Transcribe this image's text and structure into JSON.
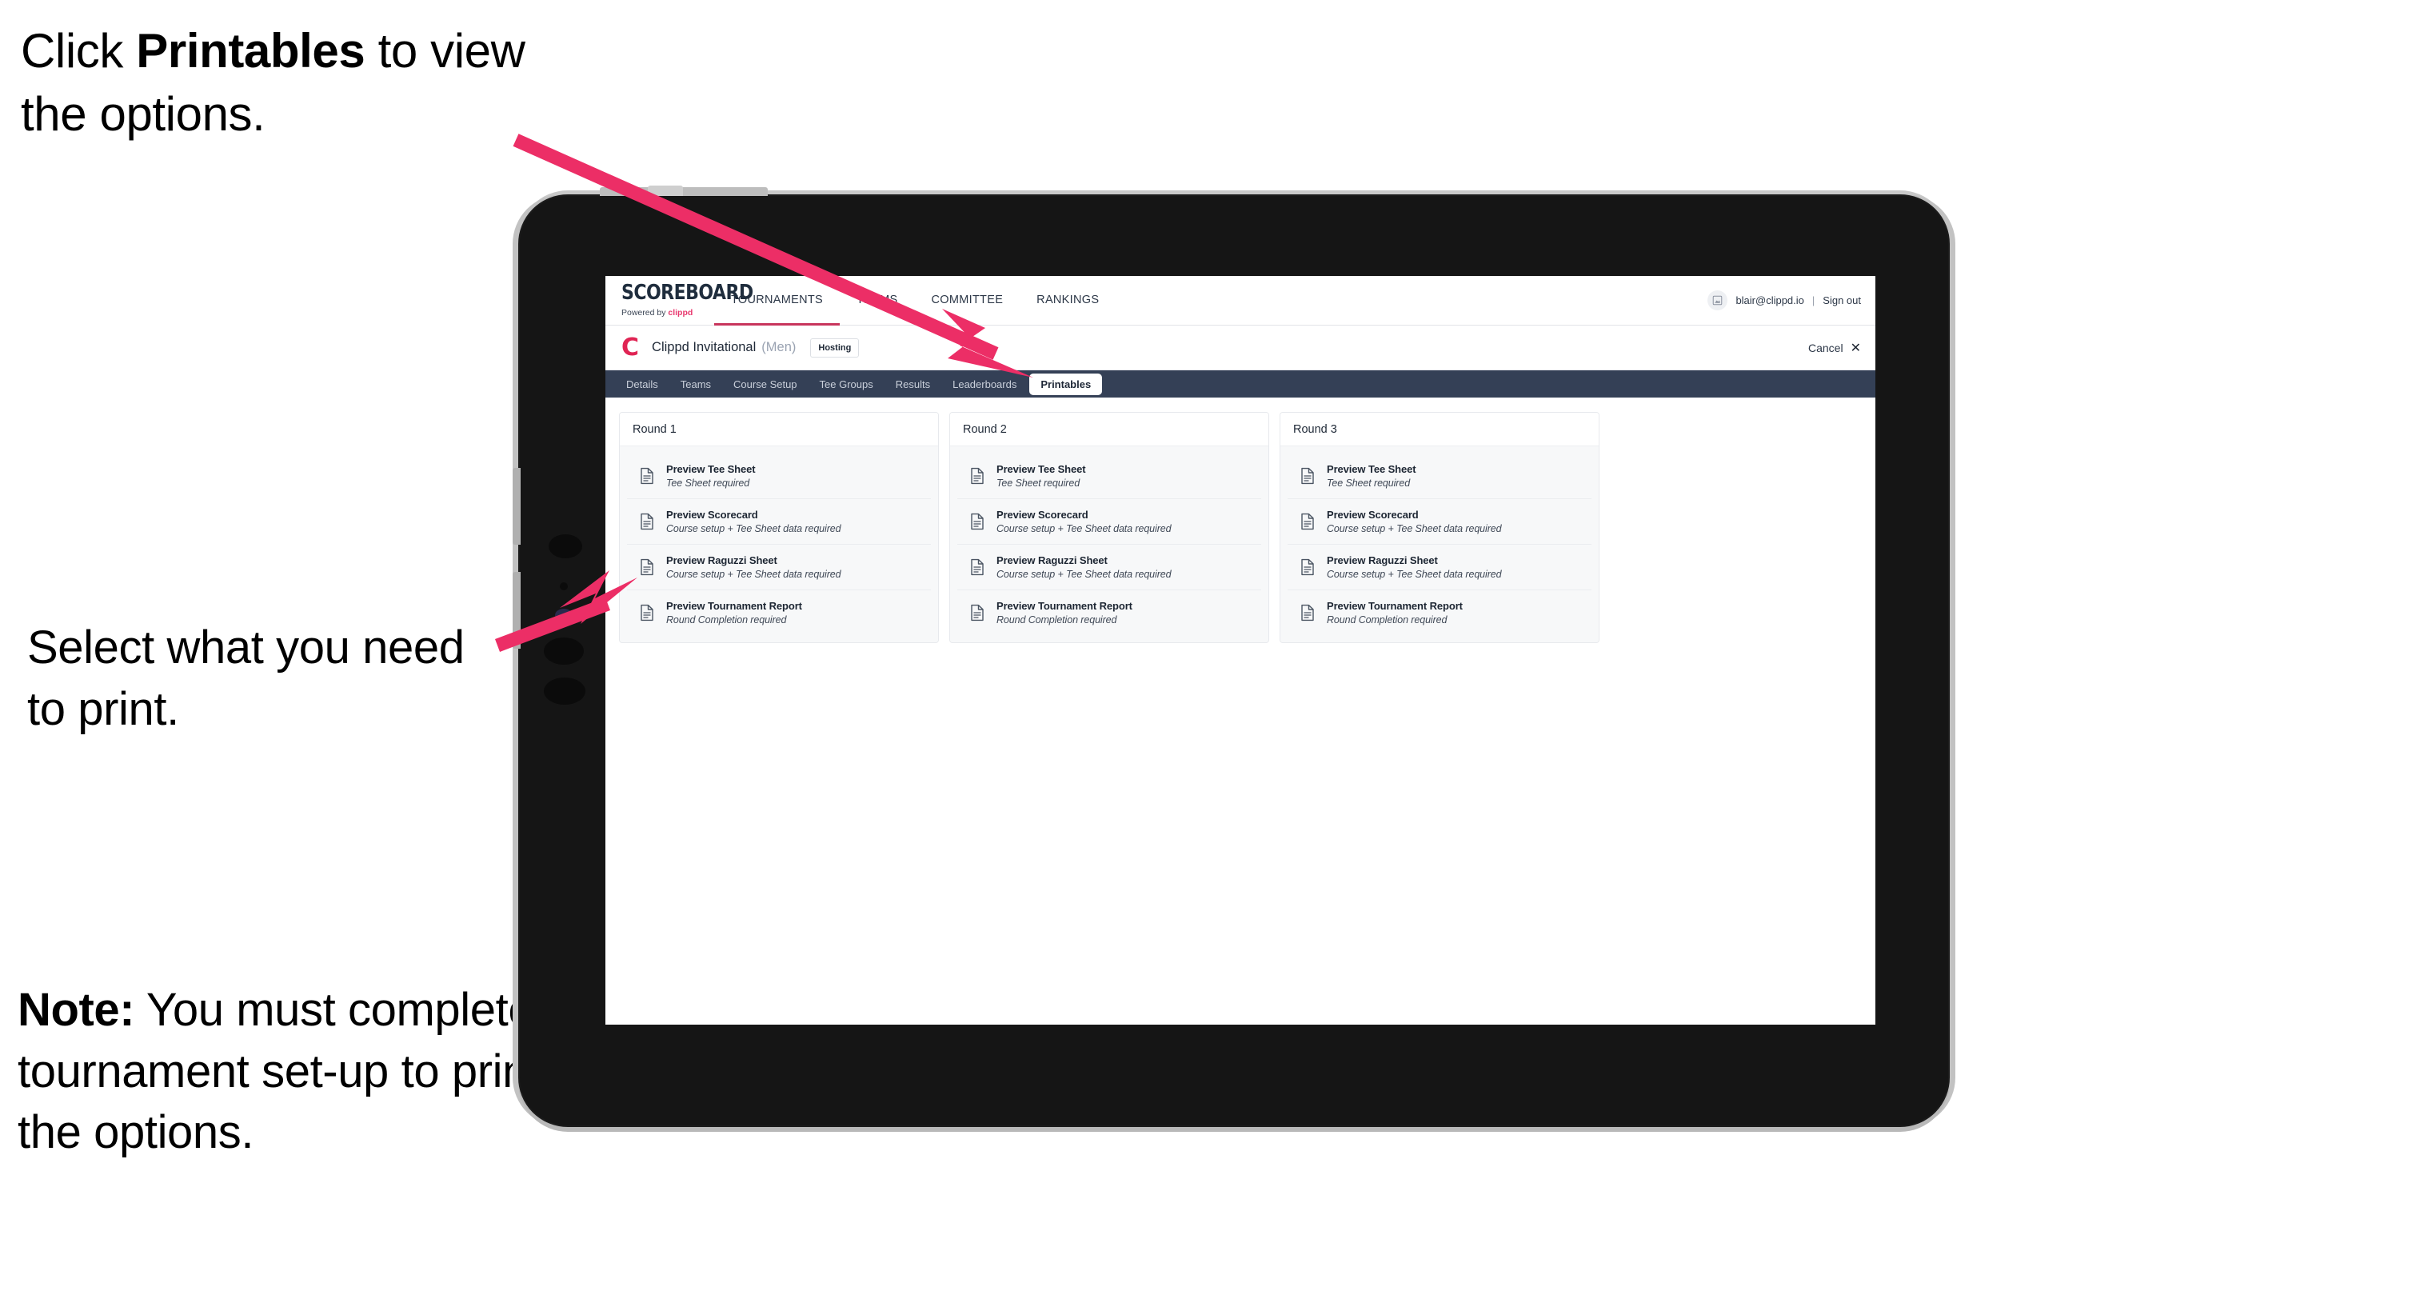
{
  "annotations": {
    "click_printables": {
      "pre": "Click ",
      "bold": "Printables",
      "post": " to view the options."
    },
    "select_print": {
      "text": "Select what you need to print."
    },
    "note": {
      "bold": "Note:",
      "text": " You must complete the tournament set-up to print all the options."
    }
  },
  "colors": {
    "accent_pink": "#ec2e66",
    "brand_red": "#e02454",
    "subnav_dark": "#344056",
    "card_bg": "#f7f8f9"
  },
  "app": {
    "brand": {
      "title": "SCOREBOARD",
      "powered_prefix": "Powered by ",
      "powered_brand": "clippd"
    },
    "main_nav": [
      {
        "label": "TOURNAMENTS",
        "active": true
      },
      {
        "label": "TEAMS",
        "active": false
      },
      {
        "label": "COMMITTEE",
        "active": false
      },
      {
        "label": "RANKINGS",
        "active": false
      }
    ],
    "user": {
      "avatar_icon": "user-avatar-icon",
      "email": "blair@clippd.io",
      "separator": "|",
      "sign_out": "Sign out"
    },
    "tournament_bar": {
      "logo_letter": "C",
      "name": "Clippd Invitational",
      "gender": "(Men)",
      "status_badge": "Hosting",
      "cancel_label": "Cancel",
      "close_icon": "close-x-icon"
    },
    "sub_nav": [
      {
        "label": "Details",
        "active": false
      },
      {
        "label": "Teams",
        "active": false
      },
      {
        "label": "Course Setup",
        "active": false
      },
      {
        "label": "Tee Groups",
        "active": false
      },
      {
        "label": "Results",
        "active": false
      },
      {
        "label": "Leaderboards",
        "active": false
      },
      {
        "label": "Printables",
        "active": true
      }
    ],
    "rounds": [
      {
        "header": "Round 1",
        "cards": [
          {
            "icon": "document-icon",
            "title": "Preview Tee Sheet",
            "subtitle": "Tee Sheet required"
          },
          {
            "icon": "document-icon",
            "title": "Preview Scorecard",
            "subtitle": "Course setup + Tee Sheet data required"
          },
          {
            "icon": "document-icon",
            "title": "Preview Raguzzi Sheet",
            "subtitle": "Course setup + Tee Sheet data required"
          },
          {
            "icon": "document-icon",
            "title": "Preview Tournament Report",
            "subtitle": "Round Completion required"
          }
        ]
      },
      {
        "header": "Round 2",
        "cards": [
          {
            "icon": "document-icon",
            "title": "Preview Tee Sheet",
            "subtitle": "Tee Sheet required"
          },
          {
            "icon": "document-icon",
            "title": "Preview Scorecard",
            "subtitle": "Course setup + Tee Sheet data required"
          },
          {
            "icon": "document-icon",
            "title": "Preview Raguzzi Sheet",
            "subtitle": "Course setup + Tee Sheet data required"
          },
          {
            "icon": "document-icon",
            "title": "Preview Tournament Report",
            "subtitle": "Round Completion required"
          }
        ]
      },
      {
        "header": "Round 3",
        "cards": [
          {
            "icon": "document-icon",
            "title": "Preview Tee Sheet",
            "subtitle": "Tee Sheet required"
          },
          {
            "icon": "document-icon",
            "title": "Preview Scorecard",
            "subtitle": "Course setup + Tee Sheet data required"
          },
          {
            "icon": "document-icon",
            "title": "Preview Raguzzi Sheet",
            "subtitle": "Course setup + Tee Sheet data required"
          },
          {
            "icon": "document-icon",
            "title": "Preview Tournament Report",
            "subtitle": "Round Completion required"
          }
        ]
      }
    ]
  }
}
